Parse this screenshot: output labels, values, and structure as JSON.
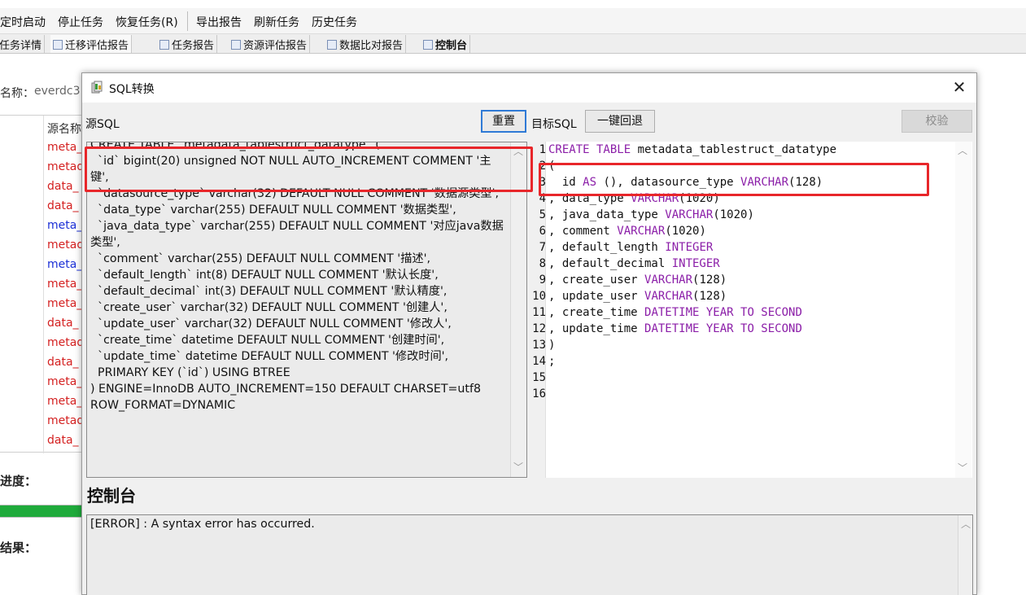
{
  "menubar": {
    "items": [
      "定时启动",
      "停止任务",
      "恢复任务(R)",
      "导出报告",
      "刷新任务",
      "历史任务"
    ]
  },
  "tabs": [
    "任务详情",
    "迁移评估报告",
    "任务报告",
    "资源评估报告",
    "数据比对报告",
    "控制台"
  ],
  "background": {
    "name_label": "名称：",
    "name_value": "everdc3",
    "table_header": "源名称",
    "rows": [
      {
        "text": "meta_",
        "color": "#d42020"
      },
      {
        "text": "metad",
        "color": "#d42020"
      },
      {
        "text": "data_",
        "color": "#d42020"
      },
      {
        "text": "data_",
        "color": "#d42020"
      },
      {
        "text": "meta_",
        "color": "#1a2fd6"
      },
      {
        "text": "metad",
        "color": "#d42020"
      },
      {
        "text": "meta_",
        "color": "#1a2fd6"
      },
      {
        "text": "meta_",
        "color": "#d42020"
      },
      {
        "text": "meta_",
        "color": "#d42020"
      },
      {
        "text": "data_",
        "color": "#d42020"
      },
      {
        "text": "metad",
        "color": "#d42020"
      },
      {
        "text": "data_",
        "color": "#d42020"
      },
      {
        "text": "meta_",
        "color": "#d42020"
      },
      {
        "text": "meta_",
        "color": "#d42020"
      },
      {
        "text": "metad",
        "color": "#d42020"
      },
      {
        "text": "data_",
        "color": "#d42020"
      }
    ],
    "progress_label": "进度：",
    "progress_fraction": 1.0,
    "result_label": "结果："
  },
  "dialog": {
    "title": "SQL转换",
    "close_icon": "close-icon",
    "source_label": "源SQL",
    "reset_button": "重置",
    "target_label": "目标SQL",
    "rollback_button": "一键回退",
    "validate_button": "校验",
    "source_sql": "CREATE TABLE `metadata_tablestruct_datatype` (\n  `id` bigint(20) unsigned NOT NULL AUTO_INCREMENT COMMENT '主键',\n  `datasource_type` varchar(32) DEFAULT NULL COMMENT '数据源类型',\n  `data_type` varchar(255) DEFAULT NULL COMMENT '数据类型',\n  `java_data_type` varchar(255) DEFAULT NULL COMMENT '对应java数据类型',\n  `comment` varchar(255) DEFAULT NULL COMMENT '描述',\n  `default_length` int(8) DEFAULT NULL COMMENT '默认长度',\n  `default_decimal` int(3) DEFAULT NULL COMMENT '默认精度',\n  `create_user` varchar(32) DEFAULT NULL COMMENT '创建人',\n  `update_user` varchar(32) DEFAULT NULL COMMENT '修改人',\n  `create_time` datetime DEFAULT NULL COMMENT '创建时间',\n  `update_time` datetime DEFAULT NULL COMMENT '修改时间',\n  PRIMARY KEY (`id`) USING BTREE\n) ENGINE=InnoDB AUTO_INCREMENT=150 DEFAULT CHARSET=utf8\nROW_FORMAT=DYNAMIC",
    "target_lines": [
      {
        "num": "1",
        "parts": [
          {
            "t": "CREATE TABLE",
            "k": true
          },
          {
            "t": " metadata_tablestruct_datatype",
            "k": false
          }
        ]
      },
      {
        "num": "2",
        "parts": [
          {
            "t": "(",
            "k": false
          }
        ]
      },
      {
        "num": "3",
        "parts": [
          {
            "t": "  id ",
            "k": false
          },
          {
            "t": "AS",
            "k": true
          },
          {
            "t": " (), datasource_type ",
            "k": false
          },
          {
            "t": "VARCHAR",
            "k": true
          },
          {
            "t": "(128)",
            "k": false
          }
        ]
      },
      {
        "num": "4",
        "parts": [
          {
            "t": ", data_type ",
            "k": false
          },
          {
            "t": "VARCHAR",
            "k": true
          },
          {
            "t": "(1020)",
            "k": false
          }
        ]
      },
      {
        "num": "5",
        "parts": [
          {
            "t": ", java_data_type ",
            "k": false
          },
          {
            "t": "VARCHAR",
            "k": true
          },
          {
            "t": "(1020)",
            "k": false
          }
        ]
      },
      {
        "num": "6",
        "parts": [
          {
            "t": ", comment ",
            "k": false
          },
          {
            "t": "VARCHAR",
            "k": true
          },
          {
            "t": "(1020)",
            "k": false
          }
        ]
      },
      {
        "num": "7",
        "parts": [
          {
            "t": ", default_length ",
            "k": false
          },
          {
            "t": "INTEGER",
            "k": true
          }
        ]
      },
      {
        "num": "8",
        "parts": [
          {
            "t": ", default_decimal ",
            "k": false
          },
          {
            "t": "INTEGER",
            "k": true
          }
        ]
      },
      {
        "num": "9",
        "parts": [
          {
            "t": ", create_user ",
            "k": false
          },
          {
            "t": "VARCHAR",
            "k": true
          },
          {
            "t": "(128)",
            "k": false
          }
        ]
      },
      {
        "num": "10",
        "parts": [
          {
            "t": ", update_user ",
            "k": false
          },
          {
            "t": "VARCHAR",
            "k": true
          },
          {
            "t": "(128)",
            "k": false
          }
        ]
      },
      {
        "num": "11",
        "parts": [
          {
            "t": ", create_time ",
            "k": false
          },
          {
            "t": "DATETIME YEAR TO SECOND",
            "k": true
          }
        ]
      },
      {
        "num": "12",
        "parts": [
          {
            "t": ", update_time ",
            "k": false
          },
          {
            "t": "DATETIME YEAR TO SECOND",
            "k": true
          }
        ]
      },
      {
        "num": "13",
        "parts": [
          {
            "t": ")",
            "k": false
          }
        ]
      },
      {
        "num": "14",
        "parts": [
          {
            "t": ";",
            "k": false
          }
        ]
      },
      {
        "num": "15",
        "parts": []
      },
      {
        "num": "16",
        "parts": []
      }
    ],
    "console_title": "控制台",
    "console_text": "[ERROR] : A syntax error has occurred."
  },
  "colors": {
    "keyword": "#8b1ea8",
    "highlight_box": "#e8262a",
    "focused_button_border": "#2f7ad6",
    "progress_fill": "#1faa3b"
  }
}
